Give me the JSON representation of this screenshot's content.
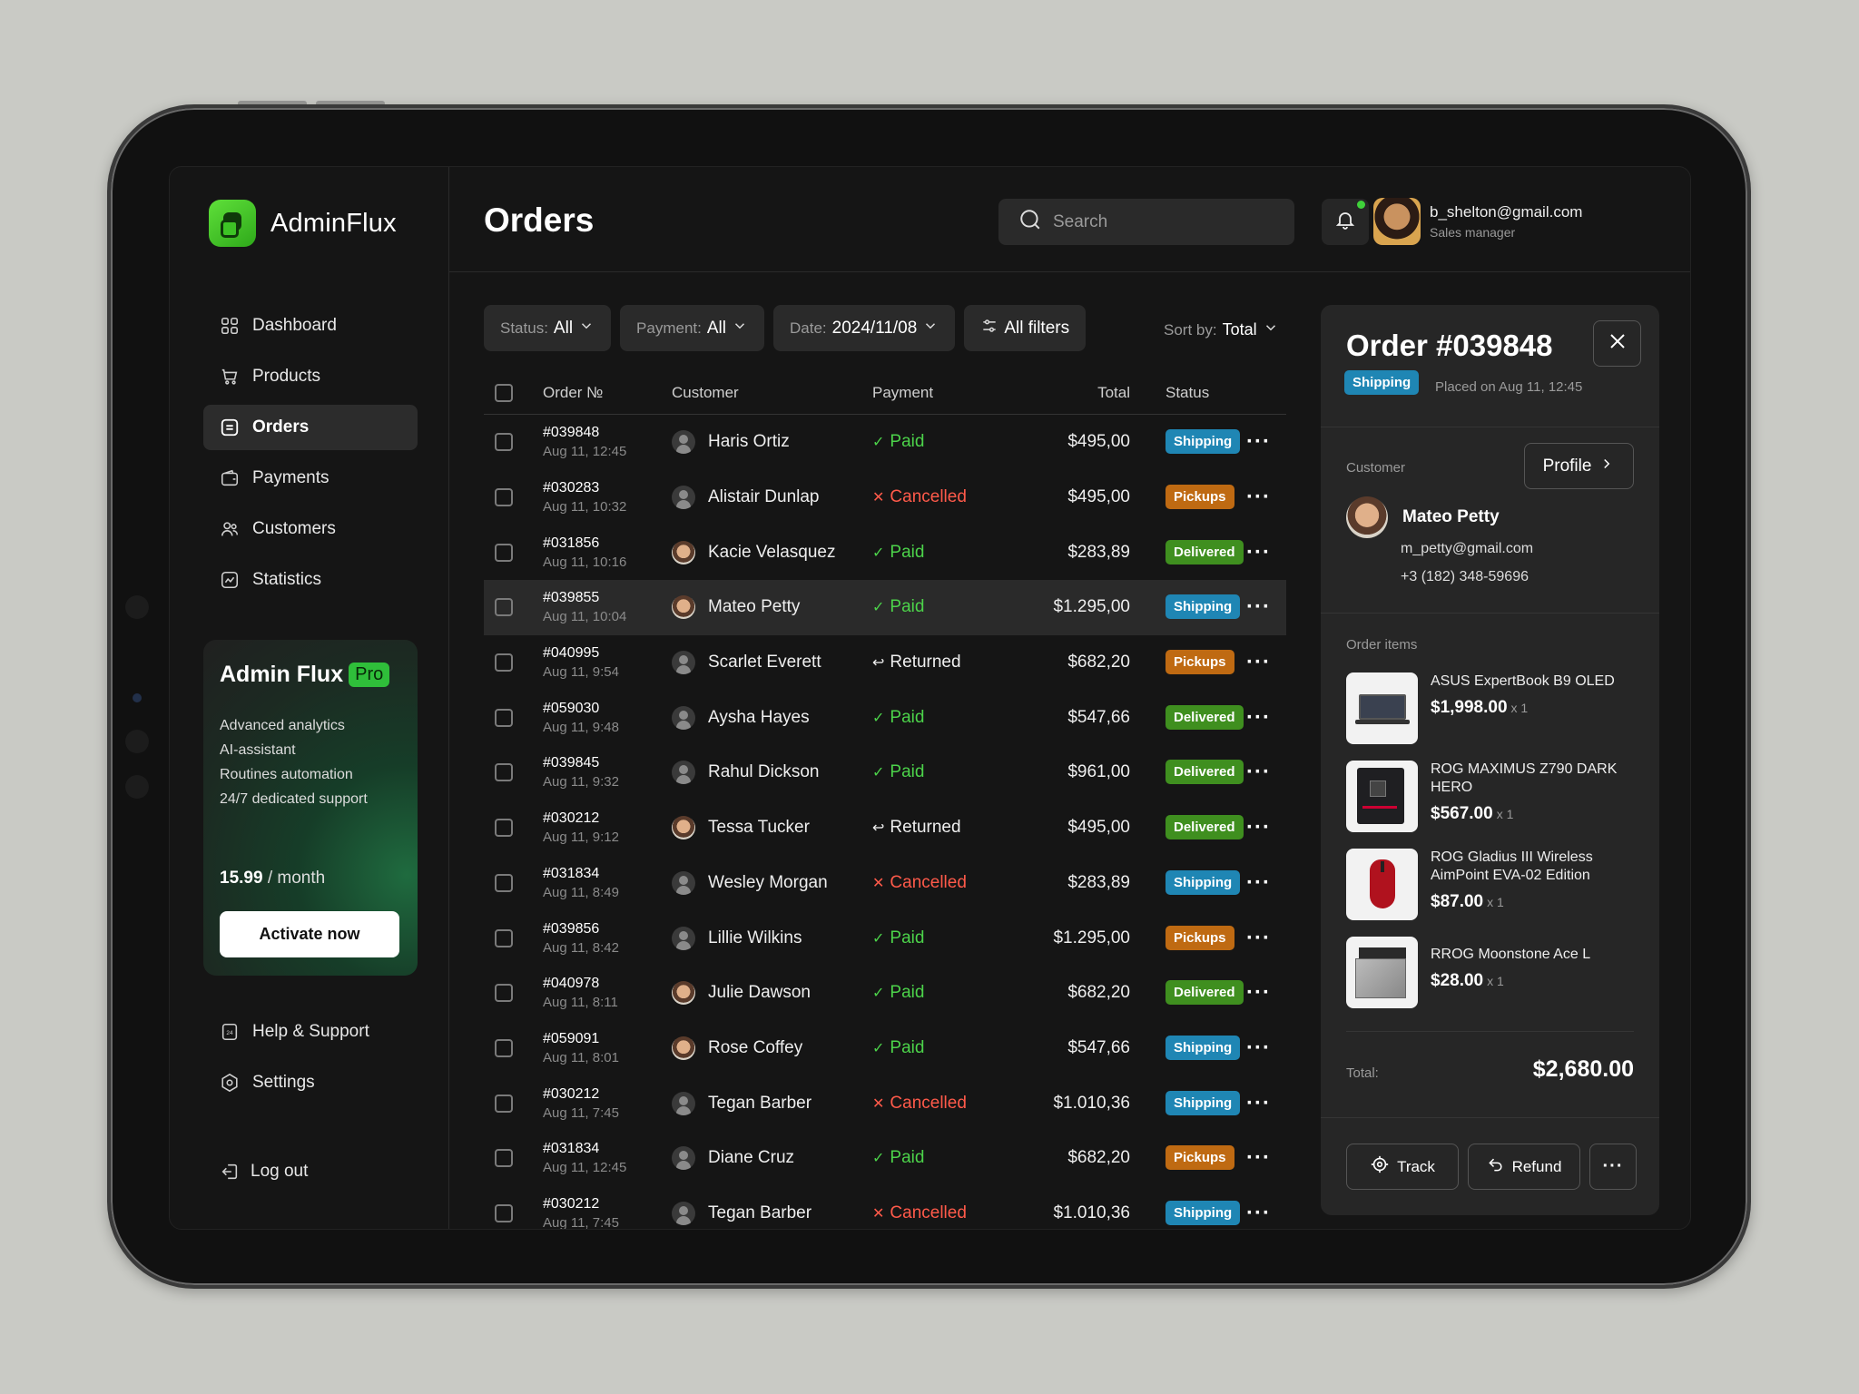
{
  "app": {
    "name": "AdminFlux"
  },
  "nav": [
    {
      "label": "Dashboard",
      "icon": "grid-icon"
    },
    {
      "label": "Products",
      "icon": "cart-icon"
    },
    {
      "label": "Orders",
      "icon": "orders-icon",
      "active": true
    },
    {
      "label": "Payments",
      "icon": "wallet-icon"
    },
    {
      "label": "Customers",
      "icon": "users-icon"
    },
    {
      "label": "Statistics",
      "icon": "chart-icon"
    }
  ],
  "promo": {
    "title": "Admin Flux",
    "badge": "Pro",
    "features": [
      "Advanced analytics",
      "AI-assistant",
      "Routines automation",
      "24/7 dedicated support"
    ],
    "price": "15.99",
    "period": "/ month",
    "button": "Activate now"
  },
  "nav_bottom": [
    {
      "label": "Help & Support",
      "icon": "support-icon"
    },
    {
      "label": "Settings",
      "icon": "settings-icon"
    }
  ],
  "logout": "Log out",
  "header": {
    "title": "Orders",
    "search_placeholder": "Search",
    "user_email": "b_shelton@gmail.com",
    "user_role": "Sales manager"
  },
  "filters": {
    "status_label": "Status:",
    "status_value": "All",
    "payment_label": "Payment:",
    "payment_value": "All",
    "date_label": "Date:",
    "date_value": "2024/11/08",
    "all_filters": "All filters",
    "sort_label": "Sort by:",
    "sort_value": "Total"
  },
  "columns": {
    "order": "Order №",
    "customer": "Customer",
    "payment": "Payment",
    "total": "Total",
    "status": "Status"
  },
  "orders": [
    {
      "id": "#039848",
      "date": "Aug 11, 12:45",
      "customer": "Haris Ortiz",
      "payment": "Paid",
      "total": "$495,00",
      "status": "Shipping"
    },
    {
      "id": "#030283",
      "date": "Aug 11, 10:32",
      "customer": "Alistair Dunlap",
      "payment": "Cancelled",
      "total": "$495,00",
      "status": "Pickups"
    },
    {
      "id": "#031856",
      "date": "Aug 11, 10:16",
      "customer": "Kacie Velasquez",
      "payment": "Paid",
      "total": "$283,89",
      "status": "Delivered"
    },
    {
      "id": "#039855",
      "date": "Aug 11, 10:04",
      "customer": "Mateo Petty",
      "payment": "Paid",
      "total": "$1.295,00",
      "status": "Shipping"
    },
    {
      "id": "#040995",
      "date": "Aug 11, 9:54",
      "customer": "Scarlet Everett",
      "payment": "Returned",
      "total": "$682,20",
      "status": "Pickups"
    },
    {
      "id": "#059030",
      "date": "Aug 11, 9:48",
      "customer": "Aysha Hayes",
      "payment": "Paid",
      "total": "$547,66",
      "status": "Delivered"
    },
    {
      "id": "#039845",
      "date": "Aug 11, 9:32",
      "customer": "Rahul Dickson",
      "payment": "Paid",
      "total": "$961,00",
      "status": "Delivered"
    },
    {
      "id": "#030212",
      "date": "Aug 11, 9:12",
      "customer": "Tessa Tucker",
      "payment": "Returned",
      "total": "$495,00",
      "status": "Delivered"
    },
    {
      "id": "#031834",
      "date": "Aug 11, 8:49",
      "customer": "Wesley Morgan",
      "payment": "Cancelled",
      "total": "$283,89",
      "status": "Shipping"
    },
    {
      "id": "#039856",
      "date": "Aug 11, 8:42",
      "customer": "Lillie Wilkins",
      "payment": "Paid",
      "total": "$1.295,00",
      "status": "Pickups"
    },
    {
      "id": "#040978",
      "date": "Aug 11, 8:11",
      "customer": "Julie Dawson",
      "payment": "Paid",
      "total": "$682,20",
      "status": "Delivered"
    },
    {
      "id": "#059091",
      "date": "Aug 11, 8:01",
      "customer": "Rose Coffey",
      "payment": "Paid",
      "total": "$547,66",
      "status": "Shipping"
    },
    {
      "id": "#030212",
      "date": "Aug 11, 7:45",
      "customer": "Tegan Barber",
      "payment": "Cancelled",
      "total": "$1.010,36",
      "status": "Shipping"
    },
    {
      "id": "#031834",
      "date": "Aug 11, 12:45",
      "customer": "Diane Cruz",
      "payment": "Paid",
      "total": "$682,20",
      "status": "Pickups"
    },
    {
      "id": "#030212",
      "date": "Aug 11, 7:45",
      "customer": "Tegan Barber",
      "payment": "Cancelled",
      "total": "$1.010,36",
      "status": "Shipping"
    }
  ],
  "panel": {
    "title": "Order #039848",
    "status": "Shipping",
    "placed": "Placed on Aug 11, 12:45",
    "customer_label": "Customer",
    "profile_button": "Profile",
    "customer_name": "Mateo Petty",
    "customer_email": "m_petty@gmail.com",
    "customer_phone": "+3 (182) 348-59696",
    "items_label": "Order items",
    "items": [
      {
        "name": "ASUS ExpertBook B9 OLED",
        "price": "$1,998.00",
        "qty": "x 1"
      },
      {
        "name": "ROG MAXIMUS Z790 DARK HERO",
        "price": "$567.00",
        "qty": "x 1"
      },
      {
        "name": "ROG Gladius III Wireless AimPoint EVA-02 Edition",
        "price": "$87.00",
        "qty": "x 1"
      },
      {
        "name": "RROG Moonstone Ace L",
        "price": "$28.00",
        "qty": "x 1"
      }
    ],
    "total_label": "Total:",
    "total_value": "$2,680.00",
    "track": "Track",
    "refund": "Refund"
  },
  "colors": {
    "paid": "#4cd34a",
    "cancelled": "#ff5a4a",
    "shipping": "#1f86b4",
    "pickups": "#bf6a12",
    "delivered": "#3f8f1f",
    "brand": "#3dc425"
  }
}
